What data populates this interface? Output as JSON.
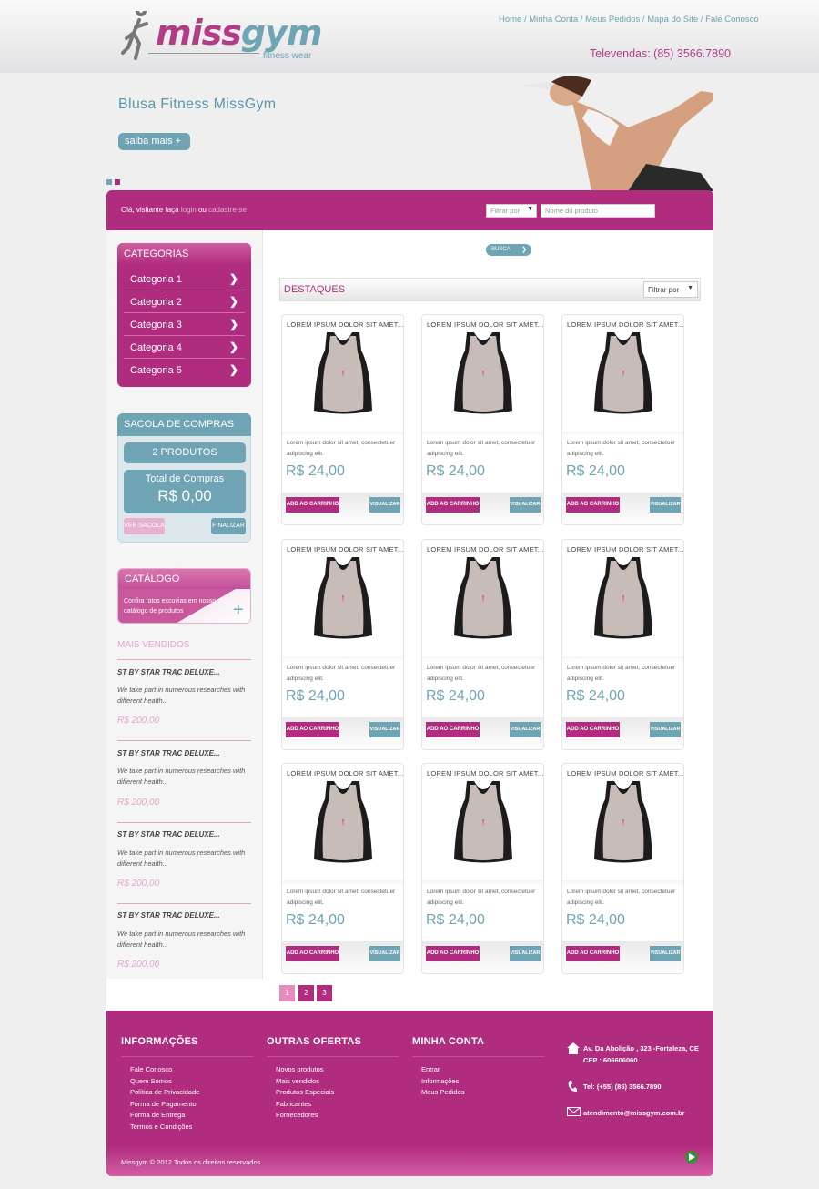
{
  "header": {
    "logo": {
      "miss": "miss",
      "gym": "gym",
      "tagline": "fitness wear"
    },
    "links": [
      "Home",
      "Minha Conta",
      "Meus Pedidos",
      "Mapa do Site",
      "Fale Conosco"
    ],
    "phone": "Televendas: (85) 3566.7890"
  },
  "hero": {
    "title": "Blusa Fitness MissGym",
    "button": "saiba mais",
    "button_icon": "+"
  },
  "bar": {
    "greeting": "Olá, visitante faça",
    "login": "login",
    "or": "ou",
    "signup": "cadastre-se",
    "filter_placeholder": "Filtrar por",
    "search_placeholder": "Nome do produto",
    "search_button": "BUSCA"
  },
  "categories": {
    "title": "CATEGORIAS",
    "items": [
      "Categoria 1",
      "Categoria 2",
      "Categoria 3",
      "Categoria 4",
      "Categoria 5"
    ]
  },
  "bag": {
    "title": "SACOLA DE COMPRAS",
    "count": "2 PRODUTOS",
    "total_label": "Total de Compras",
    "total_value": "R$ 0,00",
    "view": "VER SACOLA",
    "finish": "FINALIZAR"
  },
  "catalog": {
    "title": "CATÁLOGO",
    "text": "Confira fotos excuvias em nosso catálogo de produtos"
  },
  "best": {
    "title": "MAIS VENDIDOS",
    "items": [
      {
        "name": "ST BY STAR TRAC DELUXE...",
        "desc": "We take part in numerous researches with different health...",
        "price": "R$ 200,00"
      },
      {
        "name": "ST BY STAR TRAC DELUXE...",
        "desc": "We take part in numerous researches with different health...",
        "price": "R$ 200,00"
      },
      {
        "name": "ST BY STAR TRAC DELUXE...",
        "desc": "We take part in numerous researches with different health...",
        "price": "R$ 200,00"
      },
      {
        "name": "ST BY STAR TRAC DELUXE...",
        "desc": "We take part in numerous researches with different health...",
        "price": "R$ 200,00"
      }
    ]
  },
  "highlights": {
    "title": "DESTAQUES",
    "filter": "Filtrar por",
    "products": [
      {
        "name": "LOREM IPSUM DOLOR SIT AMET...",
        "desc": "Lorem ipsum dolor sit amet, consectetuer adipiscing elit.",
        "price": "R$ 24,00",
        "add": "ADD AO CARRINHO",
        "view": "VISUALIZAR"
      },
      {
        "name": "LOREM IPSUM DOLOR SIT AMET...",
        "desc": "Lorem ipsum dolor sit amet, consectetuer adipiscing elit.",
        "price": "R$ 24,00",
        "add": "ADD AO CARRINHO",
        "view": "VISUALIZAR"
      },
      {
        "name": "LOREM IPSUM DOLOR SIT AMET...",
        "desc": "Lorem ipsum dolor sit amet, consectetuer adipiscing elit.",
        "price": "R$ 24,00",
        "add": "ADD AO CARRINHO",
        "view": "VISUALIZAR"
      },
      {
        "name": "LOREM IPSUM DOLOR SIT AMET...",
        "desc": "Lorem ipsum dolor sit amet, consectetuer adipiscing elit.",
        "price": "R$ 24,00",
        "add": "ADD AO CARRINHO",
        "view": "VISUALIZAR"
      },
      {
        "name": "LOREM IPSUM DOLOR SIT AMET...",
        "desc": "Lorem ipsum dolor sit amet, consectetuer adipiscing elit.",
        "price": "R$ 24,00",
        "add": "ADD AO CARRINHO",
        "view": "VISUALIZAR"
      },
      {
        "name": "LOREM IPSUM DOLOR SIT AMET...",
        "desc": "Lorem ipsum dolor sit amet, consectetuer adipiscing elit.",
        "price": "R$ 24,00",
        "add": "ADD AO CARRINHO",
        "view": "VISUALIZAR"
      },
      {
        "name": "LOREM IPSUM DOLOR SIT AMET...",
        "desc": "Lorem ipsum dolor sit amet, consectetuer adipiscing elit.",
        "price": "R$ 24,00",
        "add": "ADD AO CARRINHO",
        "view": "VISUALIZAR"
      },
      {
        "name": "LOREM IPSUM DOLOR SIT AMET...",
        "desc": "Lorem ipsum dolor sit amet, consectetuer adipiscing elit.",
        "price": "R$ 24,00",
        "add": "ADD AO CARRINHO",
        "view": "VISUALIZAR"
      },
      {
        "name": "LOREM IPSUM DOLOR SIT AMET...",
        "desc": "Lorem ipsum dolor sit amet, consectetuer adipiscing elit.",
        "price": "R$ 24,00",
        "add": "ADD AO CARRINHO",
        "view": "VISUALIZAR"
      }
    ]
  },
  "pagination": [
    "1",
    "2",
    "3"
  ],
  "footer": {
    "info_title": "INFORMAÇÕES",
    "info": [
      "Fale Conosco",
      "Quem Somos",
      "Política de Privacidade",
      "Forma de Pagamento",
      "Forma de Entrega",
      "Termos e Condições"
    ],
    "offers_title": "OUTRAS OFERTAS",
    "offers": [
      "Novos produtos",
      "Mais vendidos",
      "Produtos Especiais",
      "Fabricantes",
      "Fornecedores"
    ],
    "account_title": "MINHA CONTA",
    "account": [
      "Entrar",
      "Informações",
      "Meus Pedidos"
    ],
    "address_1": "Av. Da Abolição , 323 -Fortaleza, CE",
    "address_2": "CEP : 606606060",
    "phone": "Tel: (+55) (85) 3566.7890",
    "email": "atendimento@missgym.com.br",
    "copyright": "Missgym © 2012 Todos os direitos reservados"
  },
  "colors": {
    "magenta": "#b02c7e",
    "teal": "#6ea4b4",
    "pink_light": "#e7a3cb"
  }
}
